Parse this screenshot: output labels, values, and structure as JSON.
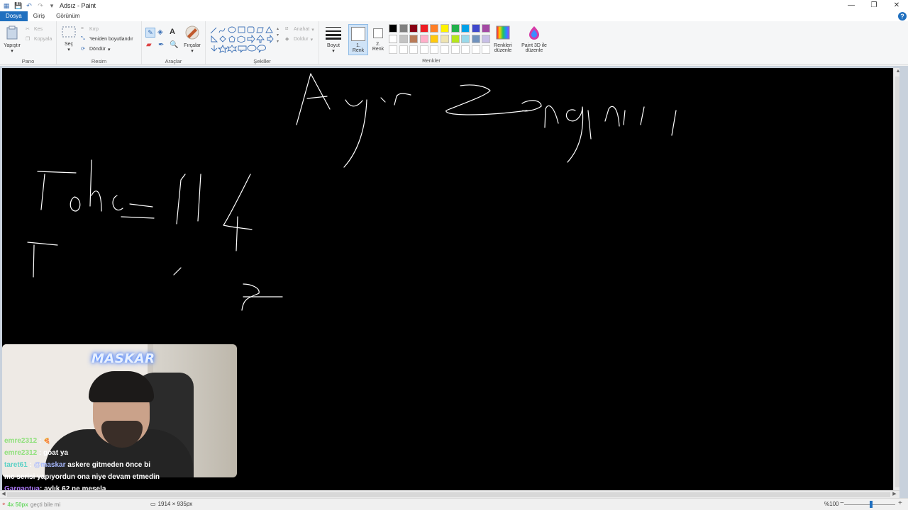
{
  "window": {
    "title": "Adsız - Paint",
    "controls": {
      "minimize": "—",
      "restore": "❐",
      "close": "✕"
    }
  },
  "quick_access": {
    "save_icon": "save-icon",
    "undo_icon": "undo-icon",
    "redo_icon": "redo-icon"
  },
  "tabs": [
    {
      "label": "Dosya",
      "active": true
    },
    {
      "label": "Giriş",
      "active": false
    },
    {
      "label": "Görünüm",
      "active": false
    }
  ],
  "ribbon": {
    "clipboard": {
      "paste": "Yapıştır",
      "cut": "Kes",
      "copy": "Kopyala",
      "group_label": "Pano"
    },
    "image": {
      "select": "Seç",
      "crop": "Kırp",
      "resize": "Yeniden boyutlandır",
      "rotate": "Döndür",
      "group_label": "Resim"
    },
    "tools": {
      "group_label": "Araçlar",
      "brushes": "Fırçalar"
    },
    "shapes": {
      "outline": "Anahat",
      "fill": "Doldur",
      "group_label": "Şekiller"
    },
    "size": {
      "label": "Boyut"
    },
    "color1": {
      "label_line1": "1.",
      "label_line2": "Renk"
    },
    "color2": {
      "label_line1": "2.",
      "label_line2": "Renk"
    },
    "colors": {
      "group_label": "Renkler",
      "row1": [
        "#000000",
        "#7f7f7f",
        "#880015",
        "#ed1c24",
        "#ff7f27",
        "#fff200",
        "#22b14c",
        "#00a2e8",
        "#3f48cc",
        "#a349a4"
      ],
      "row2": [
        "#ffffff",
        "#c3c3c3",
        "#b97a57",
        "#ffaec9",
        "#ffc90e",
        "#efe4b0",
        "#b5e61d",
        "#99d9ea",
        "#7092be",
        "#c8bfe7"
      ]
    },
    "edit_colors": {
      "line1": "Renkleri",
      "line2": "düzenle"
    },
    "paint3d": {
      "line1": "Paint 3D ile",
      "line2": "düzenle"
    }
  },
  "webcam": {
    "overlay_text": "MASKAR"
  },
  "chat": [
    {
      "user": "emre2312",
      "sep": " : ",
      "text": "",
      "emote": "🍕",
      "user_class": "u-green"
    },
    {
      "user": "emre2312",
      "sep": " : ",
      "text": "goat ya",
      "user_class": "u-green"
    },
    {
      "user": "taret61",
      "sep": " : ",
      "mention": "@maskar",
      "text": " askere gitmeden önce bi",
      "user_class": "u-cyan"
    },
    {
      "user": "",
      "sep": "",
      "text": "mc serisi yapıyordun ona niye devam etmedin",
      "user_class": ""
    },
    {
      "user": "Gargantua",
      "sep": ": ",
      "text": "aylık 62 ne mesela",
      "user_class": "u-purple"
    }
  ],
  "status": {
    "position": "4x 50px",
    "overlay_text": "geçti bile mi",
    "dimensions": "1914 × 935px",
    "zoom": "%100",
    "zoom_level": 0.53
  }
}
